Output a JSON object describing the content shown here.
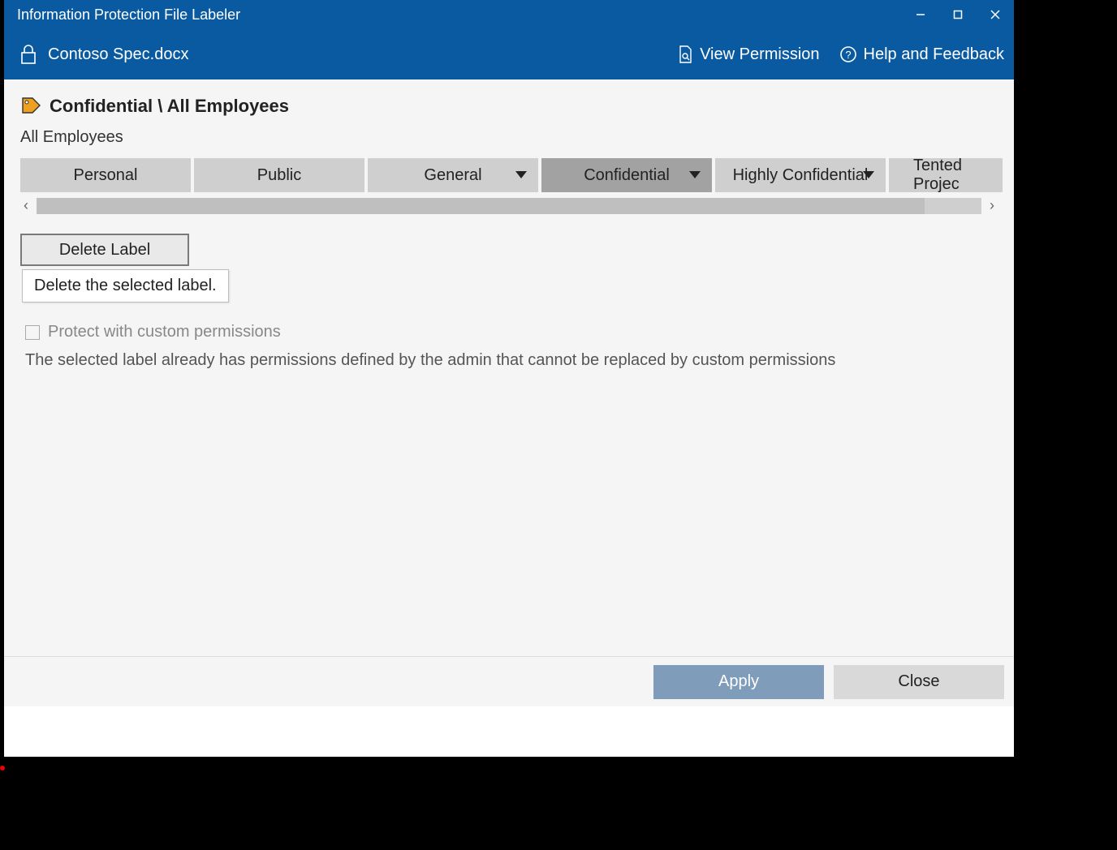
{
  "window": {
    "title": "Information Protection File Labeler"
  },
  "toolbar": {
    "filename": "Contoso Spec.docx",
    "view_permission": "View Permission",
    "help_feedback": "Help and Feedback"
  },
  "label": {
    "path": "Confidential \\ All Employees",
    "sub": "All Employees"
  },
  "chips": [
    {
      "label": "Personal",
      "dropdown": false,
      "selected": false
    },
    {
      "label": "Public",
      "dropdown": false,
      "selected": false
    },
    {
      "label": "General",
      "dropdown": true,
      "selected": false
    },
    {
      "label": "Confidential",
      "dropdown": true,
      "selected": true
    },
    {
      "label": "Highly Confidential",
      "dropdown": true,
      "selected": false
    },
    {
      "label": "Tented Projec",
      "dropdown": false,
      "selected": false
    }
  ],
  "delete": {
    "button": "Delete Label",
    "tooltip": "Delete the selected label."
  },
  "permissions": {
    "checkbox_label": "Protect with custom permissions",
    "info": "The selected label already has permissions defined by the admin that cannot be replaced by custom permissions"
  },
  "footer": {
    "apply": "Apply",
    "close": "Close"
  }
}
